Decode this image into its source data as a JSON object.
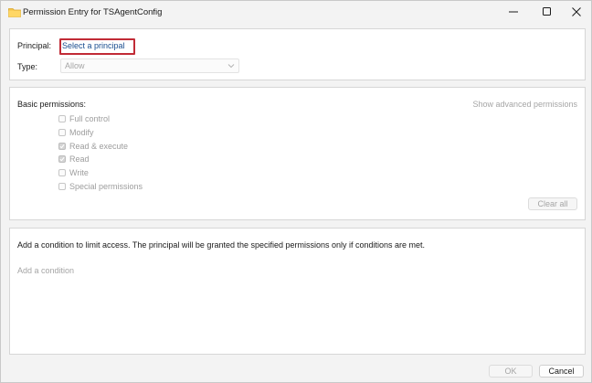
{
  "window": {
    "title": "Permission Entry for TSAgentConfig",
    "controls": [
      "minimize-icon",
      "maximize-icon",
      "close-icon"
    ]
  },
  "principal_section": {
    "principal_label": "Principal:",
    "principal_link": "Select a principal",
    "type_label": "Type:",
    "type_value": "Allow"
  },
  "permissions_section": {
    "heading": "Basic permissions:",
    "advanced_link": "Show advanced permissions",
    "items": [
      {
        "label": "Full control",
        "checked": false
      },
      {
        "label": "Modify",
        "checked": false
      },
      {
        "label": "Read & execute",
        "checked": true
      },
      {
        "label": "Read",
        "checked": true
      },
      {
        "label": "Write",
        "checked": false
      },
      {
        "label": "Special permissions",
        "checked": false
      }
    ],
    "clear_all": "Clear all"
  },
  "condition_section": {
    "description": "Add a condition to limit access. The principal will be granted the specified permissions only if conditions are met.",
    "add_condition": "Add a condition"
  },
  "footer": {
    "ok": "OK",
    "cancel": "Cancel"
  },
  "colors": {
    "highlight_border": "#c12b36",
    "link": "#1a4d8f",
    "disabled_text": "#a5a5a5"
  }
}
